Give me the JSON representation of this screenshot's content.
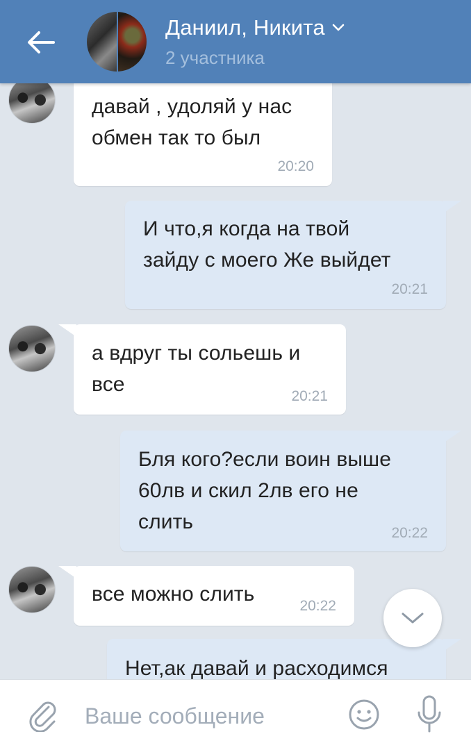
{
  "header": {
    "title": "Даниил, Никита",
    "subtitle": "2 участника",
    "back_icon": "arrow-left-icon",
    "dropdown_icon": "chevron-down-icon"
  },
  "messages": [
    {
      "direction": "in",
      "text": "давай , удоляй у нас\nобмен так то был",
      "time": "20:20"
    },
    {
      "direction": "out",
      "text": "И что,я когда на твой\nзайду с моего Же выйдет",
      "time": "20:21"
    },
    {
      "direction": "in",
      "text": "а вдруг ты сольешь и\nвсе",
      "time": "20:21"
    },
    {
      "direction": "out",
      "text": "Бля кого?если воин выше\n60лв и скил 2лв его не\nслить",
      "time": "20:22"
    },
    {
      "direction": "in",
      "text": "все можно слить",
      "time": "20:22"
    },
    {
      "direction": "out",
      "text": "Нет,ак давай и расходимся",
      "time": ""
    }
  ],
  "composer": {
    "placeholder": "Ваше сообщение",
    "value": "",
    "attach_icon": "paperclip-icon",
    "emoji_icon": "smiley-icon",
    "mic_icon": "microphone-icon"
  },
  "scroll_button_icon": "chevron-down-icon",
  "colors": {
    "header_bg": "#5181b8",
    "feed_bg": "#dfe5ec",
    "incoming_bubble": "#ffffff",
    "outgoing_bubble": "#dde8f5"
  }
}
